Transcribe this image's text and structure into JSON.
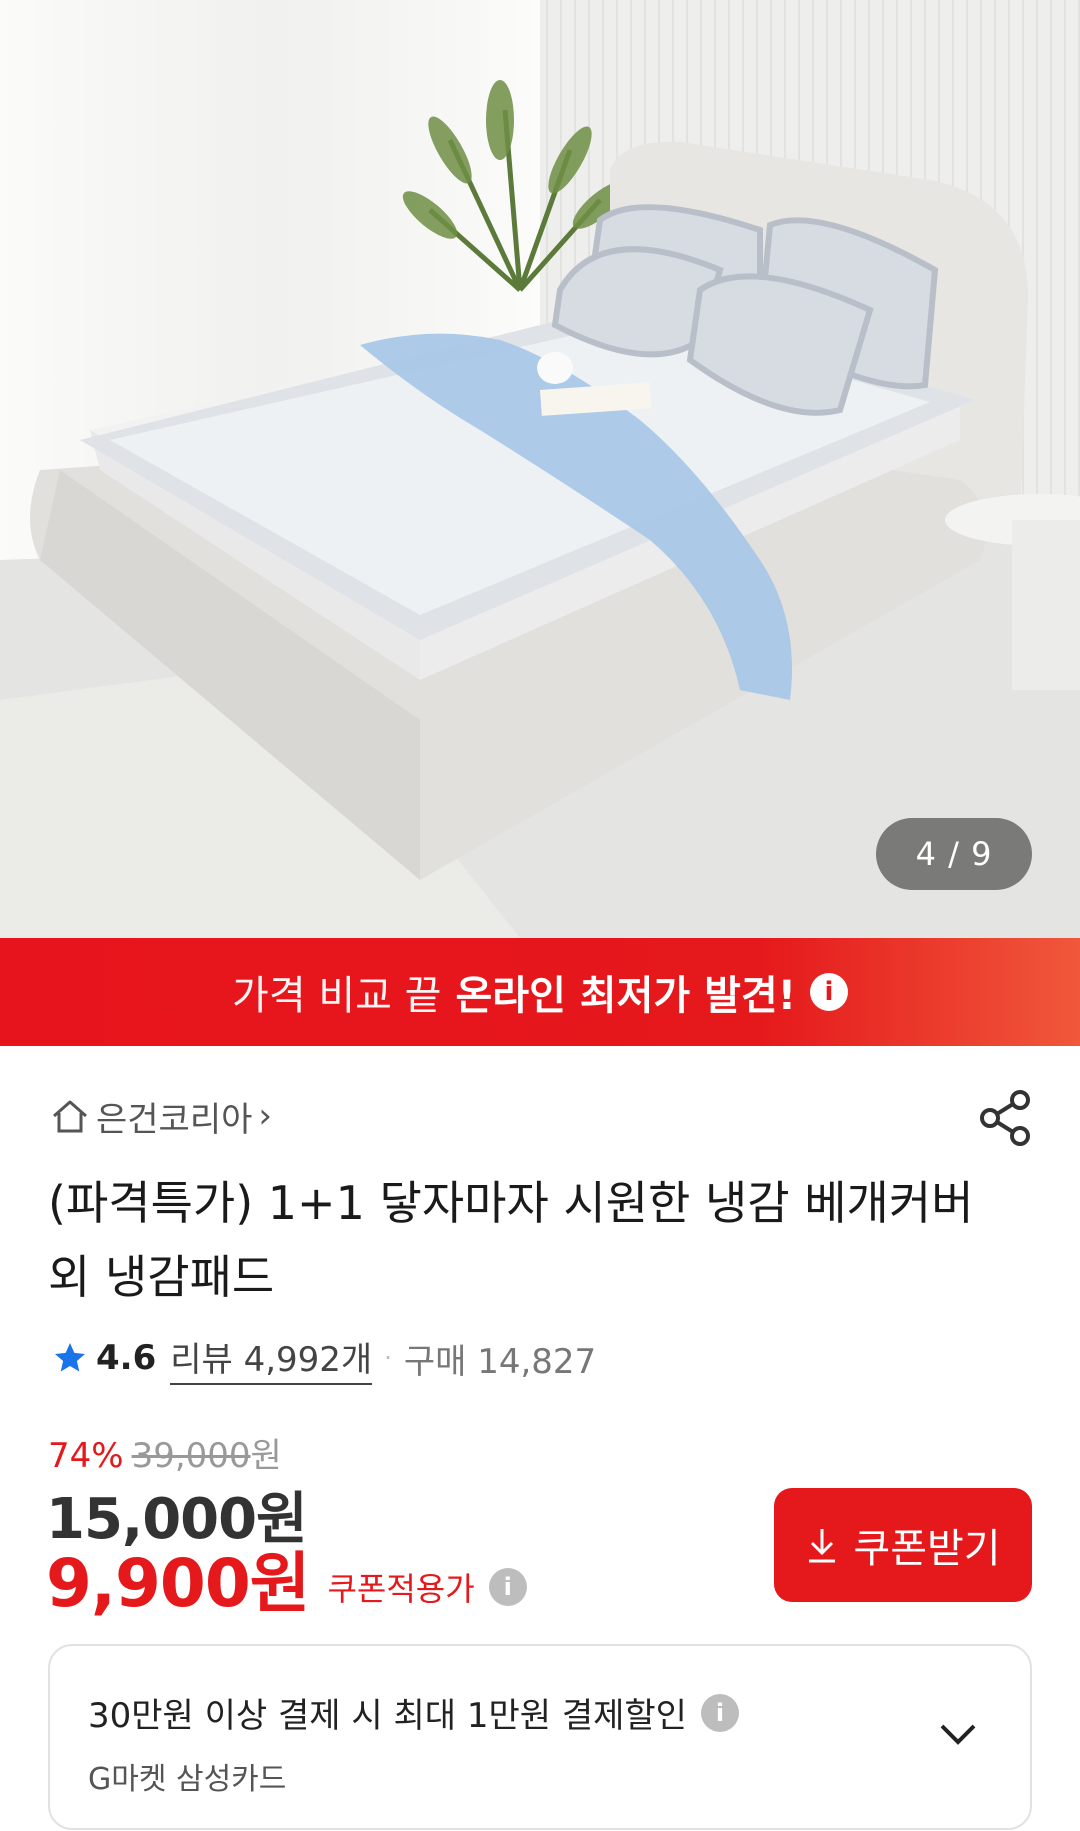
{
  "gallery": {
    "page_indicator": "4 / 9",
    "current_index": 4,
    "total": 9
  },
  "promo": {
    "normal_text": "가격 비교 끝",
    "bold_text": "온라인 최저가 발견!",
    "info_icon": "info-icon"
  },
  "seller": {
    "icon": "home-icon",
    "name": "은건코리아",
    "chevron": "›"
  },
  "product": {
    "title": "(파격특가) 1+1 닿자마자 시원한 냉감 베개커버 외 냉감패드"
  },
  "rating": {
    "score": "4.6",
    "reviews": "리뷰 4,992개",
    "separator": "·",
    "sales": "구매 14,827"
  },
  "price": {
    "discount_pct": "74%",
    "original": "39,000",
    "original_unit": "원",
    "sale": "15,000원",
    "coupon_price": "9,900원",
    "coupon_label": "쿠폰적용가"
  },
  "coupon_button": {
    "label": "쿠폰받기",
    "icon": "download-icon"
  },
  "card_offer": {
    "title": "30만원 이상 결제 시 최대 1만원 결제할인",
    "card_name": "G마켓 삼성카드"
  },
  "colors": {
    "accent": "#e5181b",
    "text": "#222222",
    "muted": "#999999"
  }
}
